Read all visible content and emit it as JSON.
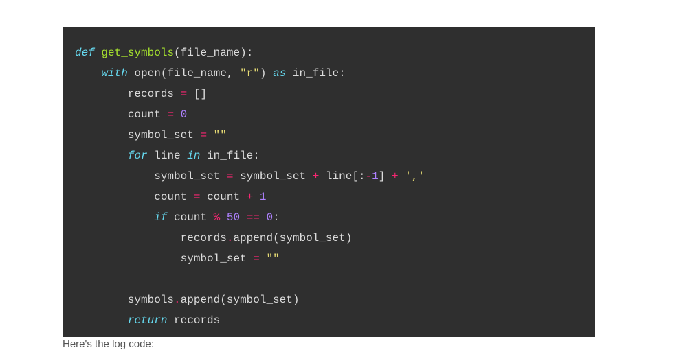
{
  "code": {
    "lines": [
      [
        {
          "cls": "tok-keyword",
          "key": "kw_def"
        },
        {
          "cls": "tok-default",
          "key": "sp"
        },
        {
          "cls": "tok-defname",
          "key": "fn_name"
        },
        {
          "cls": "tok-punct",
          "key": "lparen"
        },
        {
          "cls": "tok-default",
          "key": "param"
        },
        {
          "cls": "tok-punct",
          "key": "rparen"
        },
        {
          "cls": "tok-punct",
          "key": "colon"
        }
      ],
      [
        {
          "cls": "tok-default",
          "key": "indent1"
        },
        {
          "cls": "tok-keyword",
          "key": "kw_with"
        },
        {
          "cls": "tok-default",
          "key": "sp"
        },
        {
          "cls": "tok-default",
          "key": "fn_open"
        },
        {
          "cls": "tok-punct",
          "key": "lparen"
        },
        {
          "cls": "tok-default",
          "key": "param"
        },
        {
          "cls": "tok-punct",
          "key": "comma_sp"
        },
        {
          "cls": "tok-string",
          "key": "str_r"
        },
        {
          "cls": "tok-punct",
          "key": "rparen"
        },
        {
          "cls": "tok-default",
          "key": "sp"
        },
        {
          "cls": "tok-keyword",
          "key": "kw_as"
        },
        {
          "cls": "tok-default",
          "key": "sp"
        },
        {
          "cls": "tok-default",
          "key": "var_infile"
        },
        {
          "cls": "tok-punct",
          "key": "colon"
        }
      ],
      [
        {
          "cls": "tok-default",
          "key": "indent2"
        },
        {
          "cls": "tok-default",
          "key": "var_records"
        },
        {
          "cls": "tok-default",
          "key": "sp"
        },
        {
          "cls": "tok-op",
          "key": "op_eq"
        },
        {
          "cls": "tok-default",
          "key": "sp"
        },
        {
          "cls": "tok-punct",
          "key": "empty_list"
        }
      ],
      [
        {
          "cls": "tok-default",
          "key": "indent2"
        },
        {
          "cls": "tok-default",
          "key": "var_count"
        },
        {
          "cls": "tok-default",
          "key": "sp"
        },
        {
          "cls": "tok-op",
          "key": "op_eq"
        },
        {
          "cls": "tok-default",
          "key": "sp"
        },
        {
          "cls": "tok-num",
          "key": "num_0"
        }
      ],
      [
        {
          "cls": "tok-default",
          "key": "indent2"
        },
        {
          "cls": "tok-default",
          "key": "var_symbolset"
        },
        {
          "cls": "tok-default",
          "key": "sp"
        },
        {
          "cls": "tok-op",
          "key": "op_eq"
        },
        {
          "cls": "tok-default",
          "key": "sp"
        },
        {
          "cls": "tok-string",
          "key": "str_empty"
        }
      ],
      [
        {
          "cls": "tok-default",
          "key": "indent2"
        },
        {
          "cls": "tok-keyword",
          "key": "kw_for"
        },
        {
          "cls": "tok-default",
          "key": "sp"
        },
        {
          "cls": "tok-default",
          "key": "var_line"
        },
        {
          "cls": "tok-default",
          "key": "sp"
        },
        {
          "cls": "tok-keyword",
          "key": "kw_in"
        },
        {
          "cls": "tok-default",
          "key": "sp"
        },
        {
          "cls": "tok-default",
          "key": "var_infile"
        },
        {
          "cls": "tok-punct",
          "key": "colon"
        }
      ],
      [
        {
          "cls": "tok-default",
          "key": "indent3"
        },
        {
          "cls": "tok-default",
          "key": "var_symbolset"
        },
        {
          "cls": "tok-default",
          "key": "sp"
        },
        {
          "cls": "tok-op",
          "key": "op_eq"
        },
        {
          "cls": "tok-default",
          "key": "sp"
        },
        {
          "cls": "tok-default",
          "key": "var_symbolset"
        },
        {
          "cls": "tok-default",
          "key": "sp"
        },
        {
          "cls": "tok-op",
          "key": "op_plus"
        },
        {
          "cls": "tok-default",
          "key": "sp"
        },
        {
          "cls": "tok-default",
          "key": "var_line"
        },
        {
          "cls": "tok-punct",
          "key": "lbracket"
        },
        {
          "cls": "tok-punct",
          "key": "colon"
        },
        {
          "cls": "tok-op",
          "key": "op_minus"
        },
        {
          "cls": "tok-num",
          "key": "num_1"
        },
        {
          "cls": "tok-punct",
          "key": "rbracket"
        },
        {
          "cls": "tok-default",
          "key": "sp"
        },
        {
          "cls": "tok-op",
          "key": "op_plus"
        },
        {
          "cls": "tok-default",
          "key": "sp"
        },
        {
          "cls": "tok-string",
          "key": "str_comma"
        }
      ],
      [
        {
          "cls": "tok-default",
          "key": "indent3"
        },
        {
          "cls": "tok-default",
          "key": "var_count"
        },
        {
          "cls": "tok-default",
          "key": "sp"
        },
        {
          "cls": "tok-op",
          "key": "op_eq"
        },
        {
          "cls": "tok-default",
          "key": "sp"
        },
        {
          "cls": "tok-default",
          "key": "var_count"
        },
        {
          "cls": "tok-default",
          "key": "sp"
        },
        {
          "cls": "tok-op",
          "key": "op_plus"
        },
        {
          "cls": "tok-default",
          "key": "sp"
        },
        {
          "cls": "tok-num",
          "key": "num_1"
        }
      ],
      [
        {
          "cls": "tok-default",
          "key": "indent3"
        },
        {
          "cls": "tok-keyword",
          "key": "kw_if"
        },
        {
          "cls": "tok-default",
          "key": "sp"
        },
        {
          "cls": "tok-default",
          "key": "var_count"
        },
        {
          "cls": "tok-default",
          "key": "sp"
        },
        {
          "cls": "tok-op",
          "key": "op_mod"
        },
        {
          "cls": "tok-default",
          "key": "sp"
        },
        {
          "cls": "tok-num",
          "key": "num_50"
        },
        {
          "cls": "tok-default",
          "key": "sp"
        },
        {
          "cls": "tok-op",
          "key": "op_eqeq"
        },
        {
          "cls": "tok-default",
          "key": "sp"
        },
        {
          "cls": "tok-num",
          "key": "num_0"
        },
        {
          "cls": "tok-punct",
          "key": "colon"
        }
      ],
      [
        {
          "cls": "tok-default",
          "key": "indent4"
        },
        {
          "cls": "tok-default",
          "key": "var_records"
        },
        {
          "cls": "tok-op",
          "key": "op_dot"
        },
        {
          "cls": "tok-default",
          "key": "fn_append"
        },
        {
          "cls": "tok-punct",
          "key": "lparen"
        },
        {
          "cls": "tok-default",
          "key": "var_symbolset"
        },
        {
          "cls": "tok-punct",
          "key": "rparen"
        }
      ],
      [
        {
          "cls": "tok-default",
          "key": "indent4"
        },
        {
          "cls": "tok-default",
          "key": "var_symbolset"
        },
        {
          "cls": "tok-default",
          "key": "sp"
        },
        {
          "cls": "tok-op",
          "key": "op_eq"
        },
        {
          "cls": "tok-default",
          "key": "sp"
        },
        {
          "cls": "tok-string",
          "key": "str_empty"
        }
      ],
      [],
      [
        {
          "cls": "tok-default",
          "key": "indent2"
        },
        {
          "cls": "tok-default",
          "key": "var_symbols"
        },
        {
          "cls": "tok-op",
          "key": "op_dot"
        },
        {
          "cls": "tok-default",
          "key": "fn_append"
        },
        {
          "cls": "tok-punct",
          "key": "lparen"
        },
        {
          "cls": "tok-default",
          "key": "var_symbolset"
        },
        {
          "cls": "tok-punct",
          "key": "rparen"
        }
      ],
      [
        {
          "cls": "tok-default",
          "key": "indent2"
        },
        {
          "cls": "tok-keyword",
          "key": "kw_return"
        },
        {
          "cls": "tok-default",
          "key": "sp"
        },
        {
          "cls": "tok-default",
          "key": "var_records"
        }
      ]
    ],
    "tokens": {
      "kw_def": "def",
      "kw_with": "with",
      "kw_as": "as",
      "kw_for": "for",
      "kw_in": "in",
      "kw_if": "if",
      "kw_return": "return",
      "fn_name": "get_symbols",
      "fn_open": "open",
      "fn_append": "append",
      "param": "file_name",
      "var_infile": "in_file",
      "var_records": "records",
      "var_count": "count",
      "var_symbolset": "symbol_set",
      "var_symbols": "symbols",
      "var_line": "line",
      "str_r": "\"r\"",
      "str_empty": "\"\"",
      "str_comma": "','",
      "num_0": "0",
      "num_1": "1",
      "num_50": "50",
      "op_eq": "=",
      "op_plus": "+",
      "op_minus": "-",
      "op_mod": "%",
      "op_eqeq": "==",
      "op_dot": ".",
      "lparen": "(",
      "rparen": ")",
      "lbracket": "[",
      "rbracket": "]",
      "colon": ":",
      "comma_sp": ", ",
      "empty_list": "[]",
      "sp": " ",
      "indent1": "    ",
      "indent2": "        ",
      "indent3": "            ",
      "indent4": "                "
    }
  },
  "below_text": "Here's the log code:"
}
